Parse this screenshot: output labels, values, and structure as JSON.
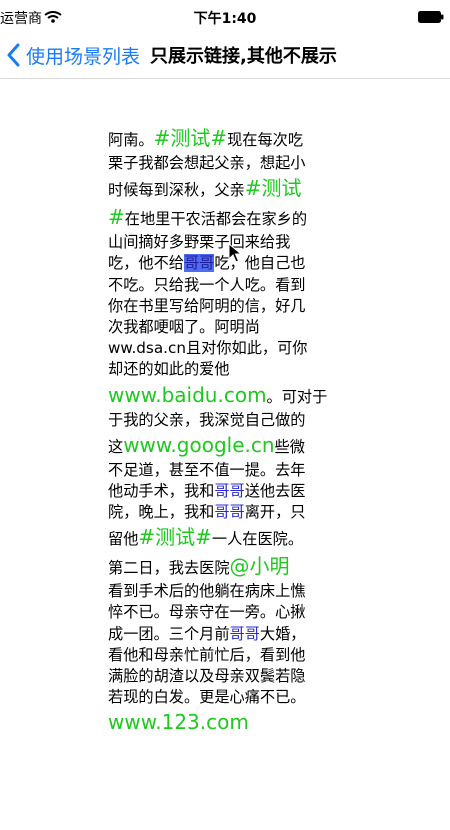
{
  "status_bar": {
    "carrier": "运营商",
    "time": "下午1:40"
  },
  "nav": {
    "back_label": "使用场景列表",
    "title": "只展示链接,其他不展示"
  },
  "colors": {
    "link_green": "#1ec91e",
    "mention_blue": "#2b2bd6",
    "ios_blue": "#1a7cf5",
    "selection": "#4f6bf0"
  },
  "icons": [
    "wifi-icon",
    "battery-icon",
    "back-chevron-icon",
    "cursor-icon"
  ],
  "content": {
    "lines": [
      [
        {
          "t": "阿南。"
        },
        {
          "t": "#测试#",
          "c": "green",
          "big": true
        },
        {
          "t": "现在每次吃"
        }
      ],
      [
        {
          "t": "栗子我都会想起父亲，想起小"
        }
      ],
      [
        {
          "t": "时候每到深秋，父亲"
        },
        {
          "t": "#测试",
          "c": "green",
          "big": true
        }
      ],
      [
        {
          "t": "#",
          "c": "green",
          "big": true
        },
        {
          "t": "在地里干农活都会在家乡的"
        }
      ],
      [
        {
          "t": "山间摘好多野栗子回来给我"
        }
      ],
      [
        {
          "t": "吃，他不给"
        },
        {
          "t": "哥哥",
          "c": "blue",
          "sel": true
        },
        {
          "t": "吃，他自己也"
        }
      ],
      [
        {
          "t": "不吃。只给我一个人吃。看到"
        }
      ],
      [
        {
          "t": "你在书里写给阿明的信，好几"
        }
      ],
      [
        {
          "t": "次我都哽咽了。阿明尚"
        }
      ],
      [
        {
          "t": "ww.dsa.cn且对你如此，可你"
        }
      ],
      [
        {
          "t": "却还的如此的爱他"
        }
      ],
      [
        {
          "t": "www.baidu.com",
          "c": "green",
          "big": true
        },
        {
          "t": "。可对于"
        }
      ],
      [
        {
          "t": "于我的父亲，我深觉自己做的"
        }
      ],
      [
        {
          "t": "这"
        },
        {
          "t": "www.google.cn",
          "c": "green",
          "big": true
        },
        {
          "t": "些微"
        }
      ],
      [
        {
          "t": "不足道，甚至不值一提。去年"
        }
      ],
      [
        {
          "t": "他动手术，我和"
        },
        {
          "t": "哥哥",
          "c": "blue"
        },
        {
          "t": "送他去医"
        }
      ],
      [
        {
          "t": "院，晚上，我和"
        },
        {
          "t": "哥哥",
          "c": "blue"
        },
        {
          "t": "离开，只"
        }
      ],
      [
        {
          "t": "留他"
        },
        {
          "t": "#测试#",
          "c": "green",
          "big": true
        },
        {
          "t": "一人在医院。"
        }
      ],
      [
        {
          "t": "第二日，我去医院"
        },
        {
          "t": "@小明",
          "c": "green",
          "big": true
        }
      ],
      [
        {
          "t": "看到手术后的他躺在病床上憔"
        }
      ],
      [
        {
          "t": "悴不已。母亲守在一旁。心揪"
        }
      ],
      [
        {
          "t": "成一团。三个月前"
        },
        {
          "t": "哥哥",
          "c": "blue"
        },
        {
          "t": "大婚，"
        }
      ],
      [
        {
          "t": "看他和母亲忙前忙后，看到他"
        }
      ],
      [
        {
          "t": "满脸的胡渣以及母亲双鬓若隐"
        }
      ],
      [
        {
          "t": "若现的白发。更是心痛不已。"
        }
      ],
      [
        {
          "t": "www.123.com",
          "c": "green",
          "big": true
        }
      ]
    ]
  }
}
